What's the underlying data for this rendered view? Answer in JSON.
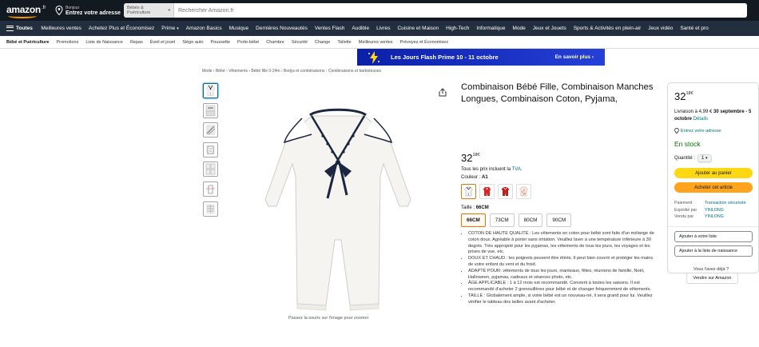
{
  "header": {
    "logo_text": "amazon",
    "logo_suffix": ".fr",
    "address_line1": "Bonjour",
    "address_line2": "Entrez votre adresse",
    "search_category": "Bébés & Puériculture",
    "search_placeholder": "Rechercher Amazon.fr"
  },
  "nav": {
    "all_label": "Toutes",
    "items": [
      "Meilleures ventes",
      "Achetez Plus et Économisez",
      "Prime",
      "Amazon Basics",
      "Musique",
      "Dernières Nouveautés",
      "Ventes Flash",
      "Audible",
      "Livres",
      "Cuisine et Maison",
      "High-Tech",
      "Informatique",
      "Mode",
      "Jeux et Jouets",
      "Sports & Activités en plein-air",
      "Jeux vidéo",
      "Santé et pro"
    ]
  },
  "subnav": {
    "items": [
      "Bébé et Puériculture",
      "Promotions",
      "Liste de Naissance",
      "Repas",
      "Éveil et jouet",
      "Siège auto",
      "Poussette",
      "Porte-bébé",
      "Chambre",
      "Sécurité",
      "Change",
      "Toilette",
      "Meilleures ventes",
      "Prévoyez et Économisez"
    ]
  },
  "banner": {
    "text": "Les Jours Flash Prime 10 - 11 octobre",
    "cta": "En savoir plus ›"
  },
  "breadcrumb": "Mode › Bébé › Vêtements › Bébé fille 0-24m › Bodys et combinaisons › Combinaisons et barboteuses",
  "product": {
    "title": "Combinaison Bébé Fille, Combinaison Manches Longues, Combinaison Coton, Pyjama,",
    "price_whole": "32",
    "price_fraction": "18€",
    "tva_prefix": "Tous les prix incluent la ",
    "tva_link": "TVA.",
    "color_label": "Couleur : ",
    "color_value": "A1",
    "size_label": "Taille : ",
    "size_value": "66CM",
    "sizes": [
      "66CM",
      "73CM",
      "80CM",
      "90CM"
    ],
    "zoom_hint": "Passez la souris sur l'image pour zoomer",
    "bullets": [
      "COTON DE HAUTE QUALITÉ : Les vêtements en coton pour bébé sont faits d'un mélange de coton doux. Agréable à porter sans irritation. Veuillez laver à une température inférieure à 30 degrés. Très approprié pour les pyjamas, les vêtements de tous les jours, les voyages et les prises de vue, etc.",
      "DOUX ET CHAUD : les poignets peuvent être étirés. Il peut bien couvrir et protéger les mains de votre enfant du vent et du froid.",
      "ADAPTÉ POUR: vêtements de tous les jours, manteaux, fêtes, réunions de famille, Noël, Halloween, pyjamas, cadeaux et séances photo, etc.",
      "ÂGE APPLICABLE : 1 à 12 mois est recommandé. Convient à toutes les saisons. Il est recommandé d'acheter 2 grenouillères pour bébé et de changer fréquemment de vêtements.",
      "TAILLE : Globalement ample, si votre bébé est un nouveau-né, il sera grand pour lui. Veuillez vérifier le tableau des tailles avant d'acheter."
    ]
  },
  "buybox": {
    "price_whole": "32",
    "price_fraction": "18€",
    "delivery_prefix": "Livraison à 4,99 € ",
    "delivery_dates": "30 septembre - 5 octobre",
    "details_link": "Détails",
    "address": "Entrez votre adresse",
    "stock": "En stock",
    "qty_label": "Quantité :",
    "qty_value": "1",
    "add_to_cart": "Ajouter au panier",
    "buy_now": "Acheter cet article",
    "payment_label": "Paiement",
    "payment_value": "Transaction sécurisée",
    "shipped_label": "Expédié par",
    "shipped_value": "YINLONG",
    "sold_label": "Vendu par",
    "sold_value": "YINLONG",
    "add_list": "Ajouter à votre liste",
    "add_birth_list": "Ajouter à la liste de naissance"
  },
  "sell": {
    "question": "Vous l'avez déjà ?",
    "button": "Vendre sur Amazon"
  },
  "colors": {
    "header_bg": "#131921",
    "nav_bg": "#232f3e",
    "accent_orange": "#ff9900",
    "cart_yellow": "#ffd814",
    "buy_orange": "#ffa41c",
    "link_teal": "#007185",
    "stock_green": "#007600",
    "banner_blue": "#1a2ec8"
  }
}
